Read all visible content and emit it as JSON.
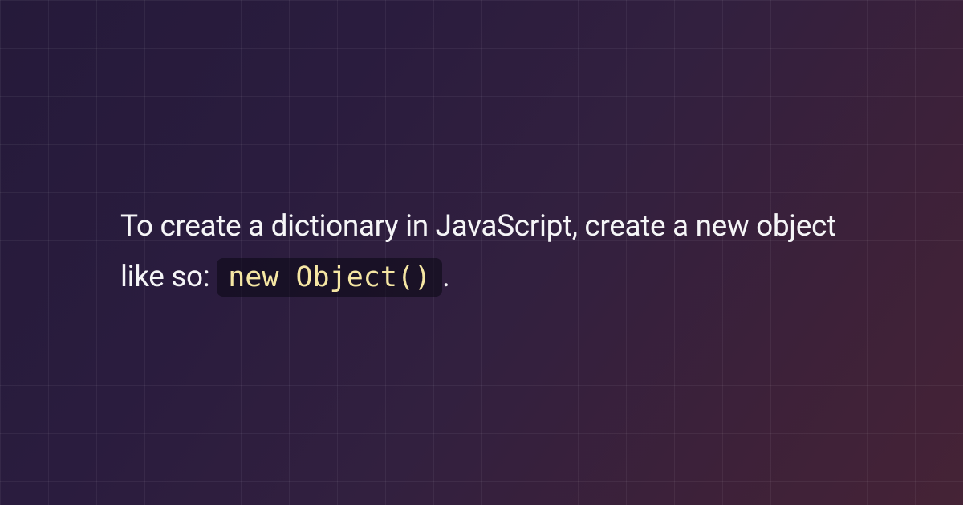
{
  "content": {
    "text_before": "To create a dictionary in JavaScript, create a new object like so: ",
    "code": "new Object()",
    "text_after": "."
  },
  "colors": {
    "bg_gradient_start": "#251a3a",
    "bg_gradient_end": "#452336",
    "text": "#f5f5f7",
    "code_text": "#f5e6a3",
    "code_bg": "rgba(10, 8, 18, 0.55)"
  }
}
